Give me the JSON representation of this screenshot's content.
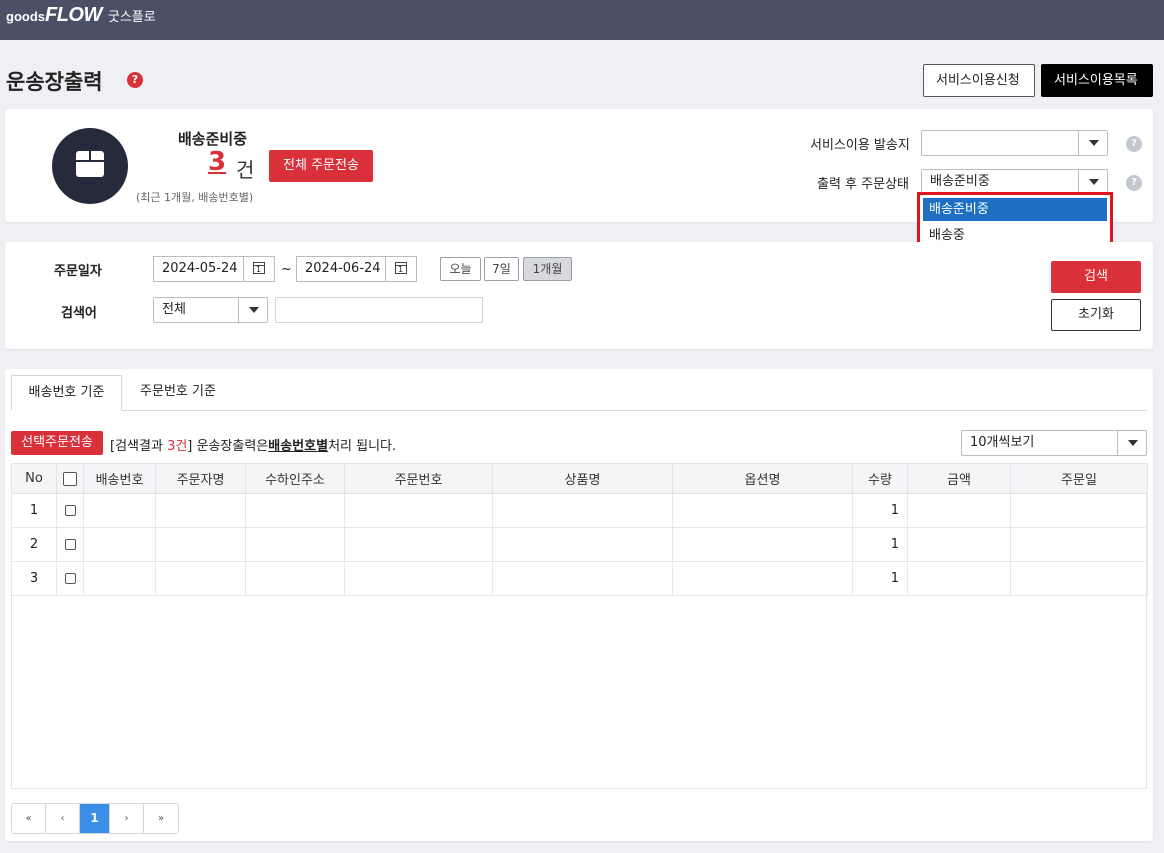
{
  "header": {
    "logo_small": "goods",
    "logo_big": "FLOW",
    "logo_kr": "굿스플로"
  },
  "page": {
    "title": "운송장출력",
    "help": "?"
  },
  "top_buttons": {
    "apply": "서비스이용신청",
    "list": "서비스이용목록"
  },
  "status": {
    "title": "배송준비중",
    "count": "3",
    "unit": "건",
    "note": "(최근 1개월, 배송번호별)",
    "send_all": "전체 주문전송"
  },
  "settings": {
    "origin_label": "서비스이용 발송지",
    "origin_value": "",
    "after_label": "출력 후 주문상태",
    "after_value": "배송준비중",
    "help": "?",
    "dropdown_options": [
      "배송준비중",
      "배송중"
    ]
  },
  "search": {
    "date_label": "주문일자",
    "date_from": "2024-05-24",
    "tilde": "~",
    "date_to": "2024-06-24",
    "periods": [
      "오늘",
      "7일",
      "1개월"
    ],
    "keyword_label": "검색어",
    "keyword_type": "전체",
    "keyword_value": "",
    "search_button": "검색",
    "reset_button": "초기화"
  },
  "tabs": [
    "배송번호 기준",
    "주문번호 기준"
  ],
  "list": {
    "select_send": "선택주문전송",
    "result_prefix": "[검색결과",
    "result_count": "3건",
    "result_mid": "] 운송장출력은",
    "result_bold": "배송번호별",
    "result_suffix": "처리 됩니다.",
    "page_size": "10개씩보기"
  },
  "table": {
    "headers": [
      "No",
      "",
      "배송번호",
      "주문자명",
      "수하인주소",
      "주문번호",
      "상품명",
      "옵션명",
      "수량",
      "금액",
      "주문일"
    ],
    "rows": [
      {
        "no": "1",
        "qty": "1"
      },
      {
        "no": "2",
        "qty": "1"
      },
      {
        "no": "3",
        "qty": "1"
      }
    ]
  },
  "pager": {
    "first": "«",
    "prev": "‹",
    "current": "1",
    "next": "›",
    "last": "»"
  }
}
